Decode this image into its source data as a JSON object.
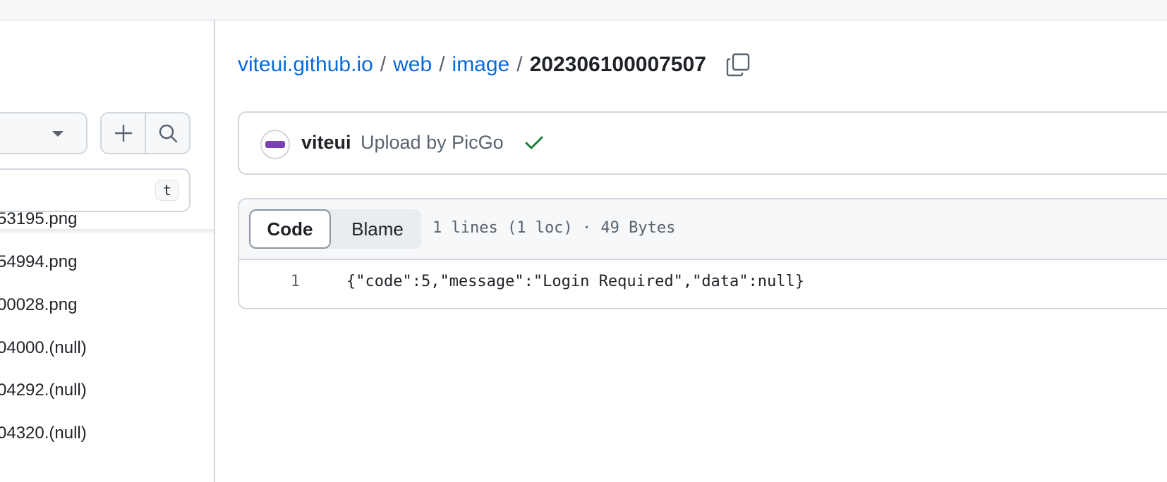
{
  "sidebar": {
    "filter_shortcut": "t",
    "files": [
      "53195.png",
      "54994.png",
      "00028.png",
      "04000.(null)",
      "04292.(null)",
      "04320.(null)"
    ]
  },
  "breadcrumb": {
    "repo": "viteui.github.io",
    "sep": "/",
    "dir1": "web",
    "dir2": "image",
    "current": "202306100007507"
  },
  "commit": {
    "author": "viteui",
    "message": "Upload by PicGo",
    "status_color": "#1a7f37"
  },
  "code_view": {
    "tab_code": "Code",
    "tab_blame": "Blame",
    "file_info": "1 lines (1 loc) · 49 Bytes",
    "line_number": "1",
    "line_content": "{\"code\":5,\"message\":\"Login Required\",\"data\":null}"
  },
  "colors": {
    "link": "#0969da",
    "border": "#d0d7de",
    "muted": "#59636e"
  },
  "icons": [
    "chevron-down-icon",
    "plus-icon",
    "search-icon",
    "copy-icon",
    "check-icon"
  ]
}
